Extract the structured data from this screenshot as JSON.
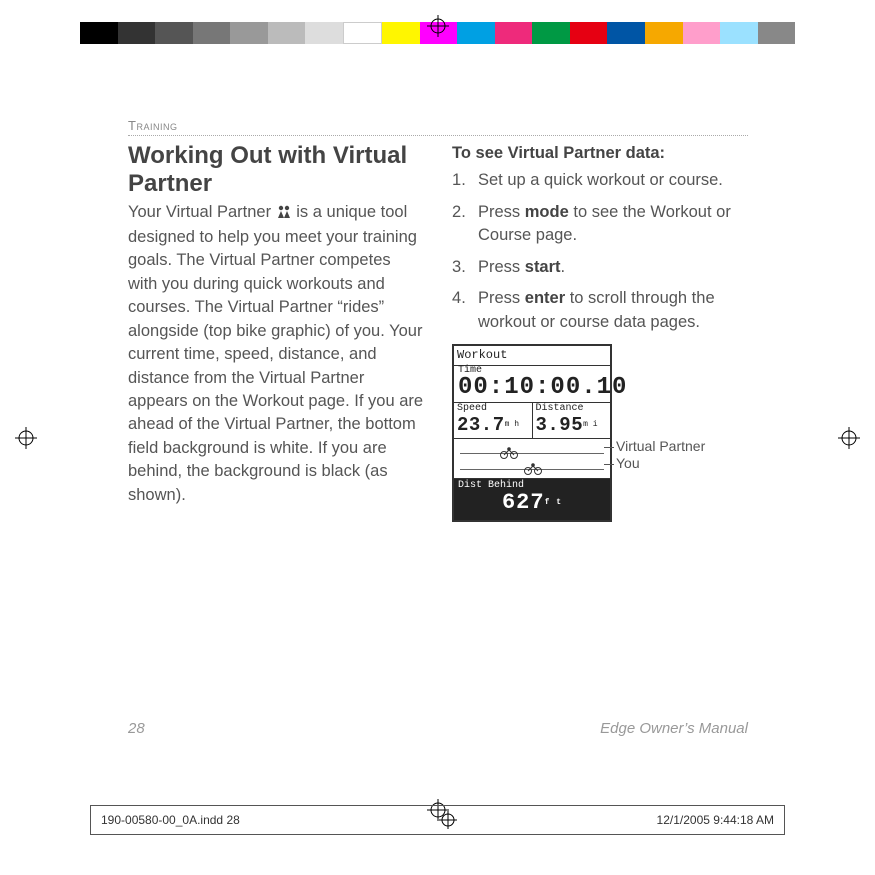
{
  "colorbar": [
    "#000",
    "#333",
    "#555",
    "#777",
    "#999",
    "#bbb",
    "#ddd",
    "#fff",
    "#fff600",
    "#ff00ff",
    "#00a0e3",
    "#ee2a7b",
    "#009944",
    "#e60012",
    "#0055a5",
    "#f6a800",
    "#ff9ecb",
    "#9be1ff",
    "#888"
  ],
  "section": "Training",
  "heading": "Working Out with Virtual Partner",
  "body": "Your Virtual Partner ",
  "body2": " is a unique tool designed to help you meet your training goals. The Virtual Partner competes with you during quick workouts and courses. The Virtual Partner “rides” alongside (top bike graphic) of you. Your current time, speed, distance, and distance from the Virtual Partner appears on the Workout page. If you are ahead of the Virtual Partner, the bottom field background is white. If you are behind, the background is black (as shown).",
  "subhead": "To see Virtual Partner data:",
  "steps": [
    {
      "pre": "Set up a quick workout or course."
    },
    {
      "pre": "Press ",
      "b": "mode",
      "post": " to see the Workout or Course page."
    },
    {
      "pre": "Press ",
      "b": "start",
      "post": "."
    },
    {
      "pre": "Press ",
      "b": "enter",
      "post": " to scroll through the workout or course data pages."
    }
  ],
  "device": {
    "title": "Workout",
    "time_label": "Time",
    "time": "00:10:00.10",
    "speed_label": "Speed",
    "speed": "23.7",
    "speed_unit": "m h",
    "dist_label": "Distance",
    "dist": "3.95",
    "dist_unit": "m i",
    "behind_label": "Dist Behind",
    "behind": "627",
    "behind_unit": "f t"
  },
  "callout_vp": "Virtual Partner",
  "callout_you": "You",
  "page_num": "28",
  "manual": "Edge Owner’s Manual",
  "slug_file": "190-00580-00_0A.indd   28",
  "slug_time": "12/1/2005   9:44:18 AM"
}
